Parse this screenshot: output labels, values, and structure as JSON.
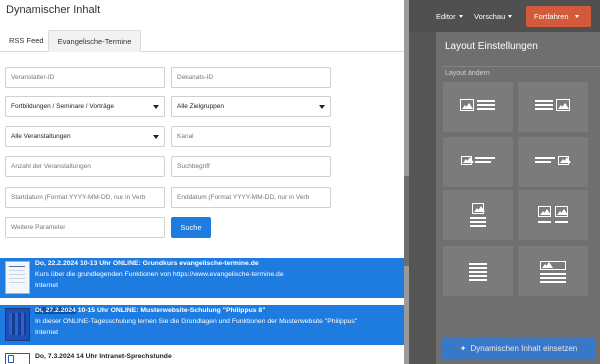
{
  "modal": {
    "title": "Dynamischer Inhalt",
    "tabs": [
      "RSS Feed",
      "Evangelische-Termine"
    ]
  },
  "form": {
    "veranstalter_placeholder": "Veranstalter-ID",
    "dekanats_placeholder": "Dekanats-ID",
    "fortbildungen_value": "Fortbildungen / Seminare / Vorträge",
    "zielgruppen_value": "Alle Zielgruppen",
    "veranstaltungen_value": "Alle Veranstaltungen",
    "kanal_placeholder": "Kanal",
    "anzahl_placeholder": "Anzahl der Veranstaltungen",
    "suchbegriff_placeholder": "Suchbegriff",
    "startdatum_placeholder": "Startdatum (Format YYYY-MM-DD, nur in Verb",
    "enddatum_placeholder": "Enddatum (Format YYYY-MM-DD, nur in Verb",
    "weitere_placeholder": "Weitere Parameter",
    "search_label": "Suche"
  },
  "results": [
    {
      "title": "Do, 22.2.2024 10-13 Uhr ONLINE: Grundkurs evangelische-termine.de",
      "desc": "Kurs über die grundlegenden Funktionen von https://www.evangelische-termine.de",
      "category": "Internet"
    },
    {
      "title_highlight": "Di, 27.2.2024",
      "title_rest": " 10-15 Uhr ONLINE: Musterwebsite-Schulung \"Philippus 8\"",
      "desc": "In dieser ONLINE-Tagesschulung lernen Sie die Grundlagen und Funktionen der Musterwebsite \"Philippus\"",
      "category": "Internet"
    },
    {
      "title": "Do, 7.3.2024 14 Uhr Intranet-Sprechstunde"
    }
  ],
  "topbar": {
    "editor": "Editor",
    "vorschau": "Vorschau",
    "fortfahren": "Fortfahren"
  },
  "panel": {
    "title": "Layout Einstellungen",
    "subtitle": "Layout ändern",
    "insert_button": "Dynamischen Inhalt einsetzen"
  }
}
